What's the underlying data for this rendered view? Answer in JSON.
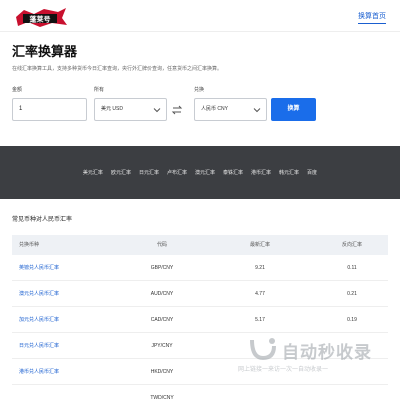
{
  "header": {
    "logo_text": "蓬莱号",
    "nav_home": "换算首页"
  },
  "page": {
    "title": "汇率换算器",
    "description": "在线汇率换算工具，支持多种货币今日汇率查询，央行外汇牌价查询，任意货币之间汇率换算。"
  },
  "form": {
    "amount_label": "金额",
    "amount_value": "1",
    "from_label": "所有",
    "from_value": "美元 USD",
    "to_label": "兑换",
    "to_value": "人民币 CNY",
    "convert_button": "换算"
  },
  "band_links": [
    "美元汇率",
    "欧元汇率",
    "日元汇率",
    "卢布汇率",
    "澳元汇率",
    "泰铢汇率",
    "港币汇率",
    "韩元汇率",
    "百度"
  ],
  "rates_section": {
    "title": "常见币种对人民币汇率",
    "columns": [
      "兑换币种",
      "代码",
      "最新汇率",
      "反向汇率"
    ],
    "rows": [
      {
        "name": "英镑兑人民币汇率",
        "code": "GBP/CNY",
        "rate": "9.21",
        "reverse": "0.11"
      },
      {
        "name": "澳元兑人民币汇率",
        "code": "AUD/CNY",
        "rate": "4.77",
        "reverse": "0.21"
      },
      {
        "name": "加元兑人民币汇率",
        "code": "CAD/CNY",
        "rate": "5.17",
        "reverse": "0.19"
      },
      {
        "name": "日元兑人民币汇率",
        "code": "JPY/CNY",
        "rate": "",
        "reverse": ""
      },
      {
        "name": "港币兑人民币汇率",
        "code": "HKD/CNY",
        "rate": "",
        "reverse": ""
      },
      {
        "name": "",
        "code": "TWD/CNY",
        "rate": "",
        "reverse": ""
      }
    ]
  },
  "watermark": {
    "title": "自动秒收录",
    "subtitle": "网上链接一来访一次一自动收录一"
  },
  "colors": {
    "accent": "#1a6dea",
    "band": "#3c3e42",
    "logo_red": "#c8102e"
  }
}
